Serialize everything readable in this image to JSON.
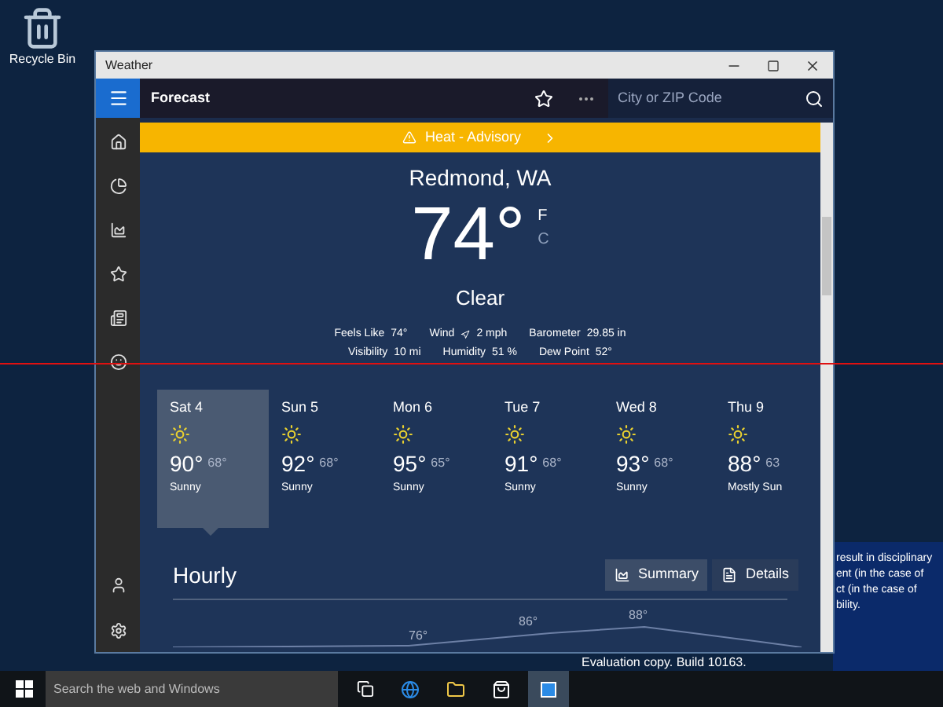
{
  "desktop": {
    "icons": [
      {
        "label": "Recycle Bin"
      }
    ]
  },
  "window": {
    "title": "Weather"
  },
  "header": {
    "title": "Forecast",
    "search_placeholder": "City or ZIP Code"
  },
  "banner": {
    "text": "Heat - Advisory"
  },
  "current": {
    "location": "Redmond, WA",
    "temperature": "74°",
    "units": [
      {
        "label": "F",
        "selected": true
      },
      {
        "label": "C",
        "selected": false
      }
    ],
    "condition": "Clear",
    "details": [
      [
        {
          "label": "Feels Like",
          "value": "74°"
        },
        {
          "label": "Wind",
          "value": "2 mph",
          "kind": "wind"
        },
        {
          "label": "Barometer",
          "value": "29.85 in"
        }
      ],
      [
        {
          "label": "Visibility",
          "value": "10 mi"
        },
        {
          "label": "Humidity",
          "value": "51 %"
        },
        {
          "label": "Dew Point",
          "value": "52°"
        }
      ]
    ]
  },
  "days": [
    {
      "day": "Sat 4",
      "high": "90°",
      "low": "68°",
      "condition": "Sunny",
      "selected": true
    },
    {
      "day": "Sun 5",
      "high": "92°",
      "low": "68°",
      "condition": "Sunny",
      "selected": false
    },
    {
      "day": "Mon 6",
      "high": "95°",
      "low": "65°",
      "condition": "Sunny",
      "selected": false
    },
    {
      "day": "Tue 7",
      "high": "91°",
      "low": "68°",
      "condition": "Sunny",
      "selected": false
    },
    {
      "day": "Wed 8",
      "high": "93°",
      "low": "68°",
      "condition": "Sunny",
      "selected": false
    },
    {
      "day": "Thu 9",
      "high": "88°",
      "low": "63",
      "condition": "Mostly Sun",
      "selected": false
    }
  ],
  "hourly": {
    "title": "Hourly",
    "views": [
      {
        "label": "Summary",
        "kind": "summary",
        "selected": true
      },
      {
        "label": "Details",
        "kind": "details",
        "selected": false
      }
    ],
    "labels": [
      "76°",
      "86°",
      "88°"
    ]
  },
  "background_window": {
    "lines": [
      "result in disciplinary",
      "ent (in the case of",
      "ct (in the case of",
      "bility."
    ]
  },
  "taskbar": {
    "search_placeholder": "Search the web and Windows",
    "status": "Evaluation copy. Build 10163."
  }
}
